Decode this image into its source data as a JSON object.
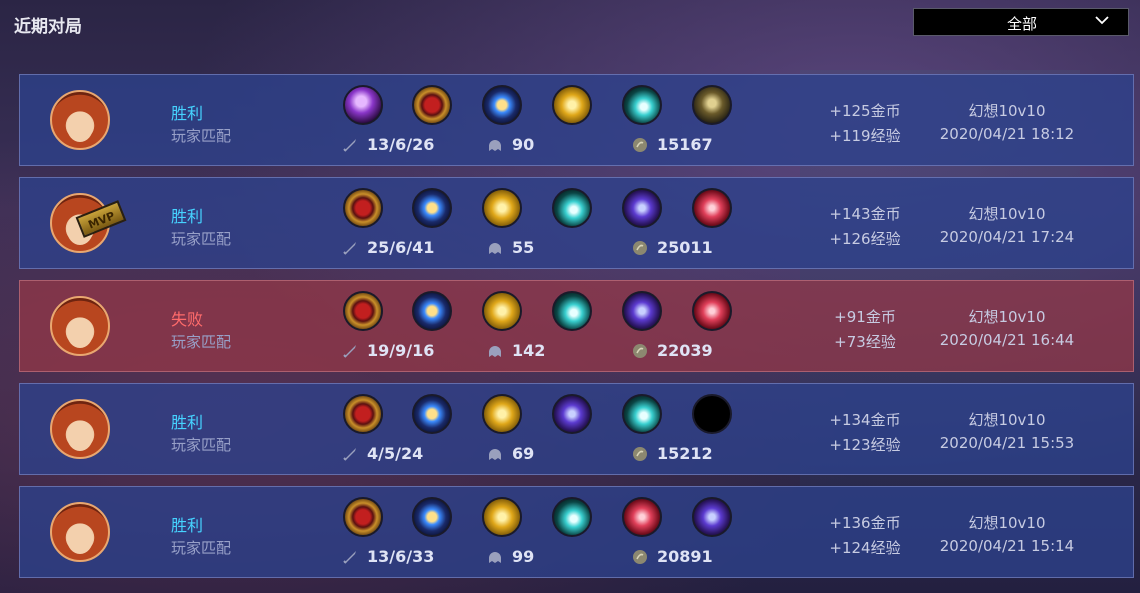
{
  "header": {
    "title": "近期对局"
  },
  "filter": {
    "selected": "全部"
  },
  "icons": {
    "kda": "sword-icon",
    "minions": "minion-icon",
    "gold": "coin-icon",
    "dropdown": "chevron-down-icon"
  },
  "colors": {
    "win": "#46d3ff",
    "loss": "#ff6b6b"
  },
  "matches": [
    {
      "result": "胜利",
      "mode": "玩家匹配",
      "mvp": false,
      "items": [
        "purple-orb-icon",
        "red-rune-icon",
        "blue-crown-icon",
        "gold-swirl-icon",
        "teal-beam-icon",
        "dark-claw-icon"
      ],
      "kda": "13/6/26",
      "minions": "90",
      "gold": "15167",
      "gold_reward": "+125金币",
      "exp_reward": "+119经验",
      "map": "幻想10v10",
      "time": "2020/04/21 18:12"
    },
    {
      "result": "胜利",
      "mode": "玩家匹配",
      "mvp": true,
      "mvp_label": "MVP",
      "items": [
        "red-rune-icon",
        "blue-crown-icon",
        "gold-swirl-icon",
        "teal-beam-icon",
        "purple-tome-icon",
        "red-crystal-icon"
      ],
      "kda": "25/6/41",
      "minions": "55",
      "gold": "25011",
      "gold_reward": "+143金币",
      "exp_reward": "+126经验",
      "map": "幻想10v10",
      "time": "2020/04/21 17:24"
    },
    {
      "result": "失败",
      "mode": "玩家匹配",
      "mvp": false,
      "items": [
        "red-rune-icon",
        "blue-crown-icon",
        "gold-swirl-icon",
        "teal-beam-icon",
        "purple-tome-icon",
        "red-crystal-icon"
      ],
      "kda": "19/9/16",
      "minions": "142",
      "gold": "22039",
      "gold_reward": "+91金币",
      "exp_reward": "+73经验",
      "map": "幻想10v10",
      "time": "2020/04/21 16:44"
    },
    {
      "result": "胜利",
      "mode": "玩家匹配",
      "mvp": false,
      "items": [
        "red-rune-icon",
        "blue-crown-icon",
        "gold-swirl-icon",
        "purple-tome-icon",
        "teal-beam-icon",
        "empty-slot-icon"
      ],
      "kda": "4/5/24",
      "minions": "69",
      "gold": "15212",
      "gold_reward": "+134金币",
      "exp_reward": "+123经验",
      "map": "幻想10v10",
      "time": "2020/04/21 15:53"
    },
    {
      "result": "胜利",
      "mode": "玩家匹配",
      "mvp": false,
      "items": [
        "red-rune-icon",
        "blue-crown-icon",
        "gold-swirl-icon",
        "teal-beam-icon",
        "red-crystal-icon",
        "purple-tome-icon"
      ],
      "kda": "13/6/33",
      "minions": "99",
      "gold": "20891",
      "gold_reward": "+136金币",
      "exp_reward": "+124经验",
      "map": "幻想10v10",
      "time": "2020/04/21 15:14"
    }
  ]
}
